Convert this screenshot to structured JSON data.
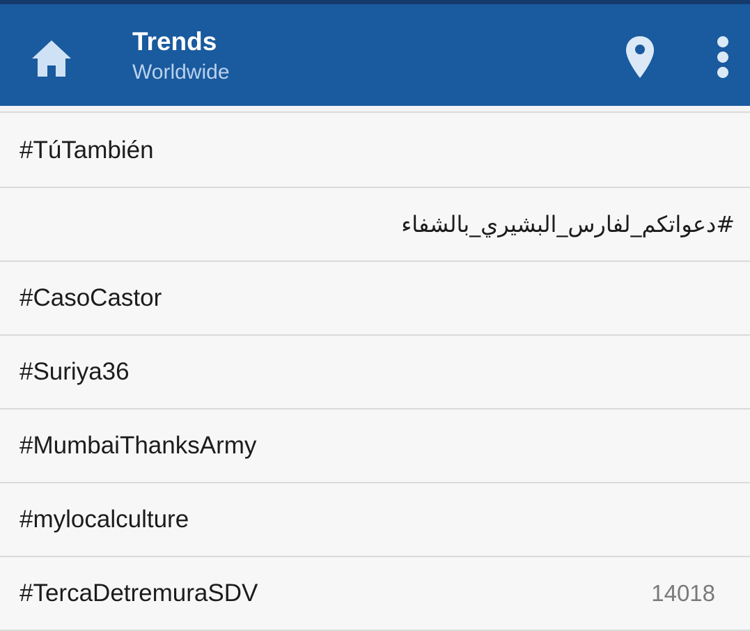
{
  "appbar": {
    "title": "Trends",
    "subtitle": "Worldwide",
    "home_icon": "home-icon",
    "location_icon": "location-pin-icon",
    "more_icon": "more-vertical-icon",
    "background_color": "#1a5a9e"
  },
  "trends": [
    {
      "tag": "#TúTambién",
      "count": "",
      "rtl": false
    },
    {
      "tag": "#دعواتكم_لفارس_البشيري_بالشفاء",
      "count": "",
      "rtl": true
    },
    {
      "tag": "#CasoCastor",
      "count": "",
      "rtl": false
    },
    {
      "tag": "#Suriya36",
      "count": "",
      "rtl": false
    },
    {
      "tag": "#MumbaiThanksArmy",
      "count": "",
      "rtl": false
    },
    {
      "tag": "#mylocalculture",
      "count": "",
      "rtl": false
    },
    {
      "tag": "#TercaDetremuraSDV",
      "count": "14018",
      "rtl": false
    }
  ]
}
